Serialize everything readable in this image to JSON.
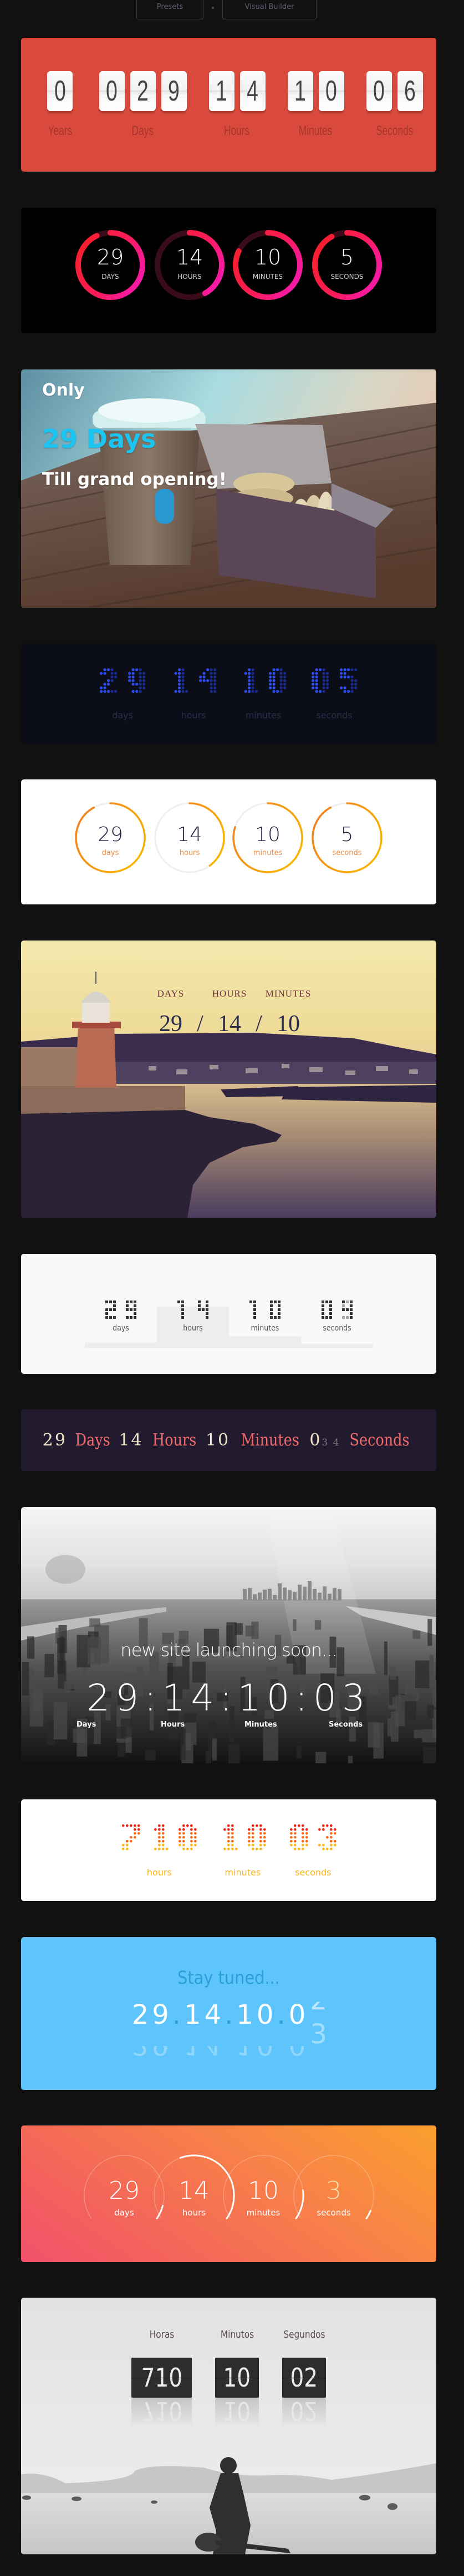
{
  "nav": {
    "presets_label": "Presets",
    "visual_builder_label": "Visual Builder"
  },
  "flip_red": {
    "bg_color": "#d94a3d",
    "units": [
      {
        "label": "Years",
        "digits": "0"
      },
      {
        "label": "Days",
        "digits": "029"
      },
      {
        "label": "Hours",
        "digits": "14"
      },
      {
        "label": "Minutes",
        "digits": "10"
      },
      {
        "label": "Seconds",
        "digits": "06"
      }
    ]
  },
  "rings_pink": {
    "track_color": "#3a0c1a",
    "gradient": [
      "#f81f2e",
      "#fb1b56",
      "#f51ab0"
    ],
    "units": [
      {
        "value": "29",
        "label": "DAYS",
        "progress": 0.93
      },
      {
        "value": "14",
        "label": "HOURS",
        "progress": 0.42
      },
      {
        "value": "10",
        "label": "MINUTES",
        "progress": 0.82
      },
      {
        "value": "5",
        "label": "SECONDS",
        "progress": 0.92
      }
    ]
  },
  "grand_opening": {
    "line1": "Only",
    "line2": "29 Days",
    "line3": "Till grand opening!",
    "accent_color": "#1cc4f2"
  },
  "led_blue": {
    "bg_color": "#0b0e16",
    "bright_color": "#2d4cf0",
    "dim_color": "#1a2a8e",
    "label_color": "#2e2b4a",
    "units": [
      {
        "value": "29",
        "label": "days"
      },
      {
        "value": "14",
        "label": "hours"
      },
      {
        "value": "10",
        "label": "minutes"
      },
      {
        "value": "05",
        "label": "seconds"
      }
    ]
  },
  "rings_orange": {
    "gradient": [
      "#f37f1f",
      "#f9b800"
    ],
    "units": [
      {
        "value": "29",
        "label": "days",
        "progress": 0.92
      },
      {
        "value": "14",
        "label": "hours",
        "progress": 0.4
      },
      {
        "value": "10",
        "label": "minutes",
        "progress": 0.8
      },
      {
        "value": "5",
        "label": "seconds",
        "progress": 0.92
      }
    ]
  },
  "vintage": {
    "labels": [
      "DAYS",
      "HOURS",
      "MINUTES"
    ],
    "values": [
      "29",
      "14",
      "10"
    ],
    "separator": "/"
  },
  "pixel_bars": {
    "units": [
      {
        "value": "29",
        "label": "days",
        "fill": 0.08
      },
      {
        "value": "14",
        "label": "hours",
        "fill": 0.58
      },
      {
        "value": "10",
        "label": "minutes",
        "fill": 0.17
      },
      {
        "value": "04",
        "next_value": "03",
        "label": "seconds",
        "fill": 0.06
      }
    ]
  },
  "inline_text": {
    "days": "29",
    "days_label": "Days",
    "hours": "14",
    "hours_label": "Hours",
    "minutes": "10",
    "minutes_label": "Minutes",
    "seconds": "0",
    "seconds_rolling": [
      "3",
      "4"
    ],
    "seconds_label": "Seconds"
  },
  "city": {
    "tagline": "new site launching soon...",
    "values": [
      "29",
      "14",
      "10",
      "03"
    ],
    "separator": ":",
    "labels": [
      "Days",
      "Hours",
      "Minutes",
      "Seconds"
    ]
  },
  "led_warm": {
    "row_colors": [
      "#f01c0c",
      "#fb6510",
      "#fbb416"
    ],
    "label_color": "#f7b51a",
    "units": [
      {
        "value": "710",
        "label": "hours"
      },
      {
        "value": "10",
        "label": "minutes"
      },
      {
        "value": "03",
        "label": "seconds"
      }
    ]
  },
  "stay_tuned": {
    "bg_color": "#5ec5fc",
    "heading": "Stay tuned...",
    "values": [
      "29",
      "14",
      "10",
      "0"
    ],
    "separator": ".",
    "rolling_out": "2",
    "rolling_in": "3"
  },
  "arcs_gradient": {
    "units": [
      {
        "value": "29",
        "label": "days",
        "progress": 0.08
      },
      {
        "value": "14",
        "label": "hours",
        "progress": 0.58
      },
      {
        "value": "10",
        "label": "minutes",
        "progress": 0.17
      },
      {
        "value": "3",
        "label": "seconds",
        "progress": 0.05
      }
    ]
  },
  "desert": {
    "units": [
      {
        "label": "Horas",
        "value": "710"
      },
      {
        "label": "Minutos",
        "value": "10"
      },
      {
        "label": "Segundos",
        "value": "02"
      }
    ]
  }
}
